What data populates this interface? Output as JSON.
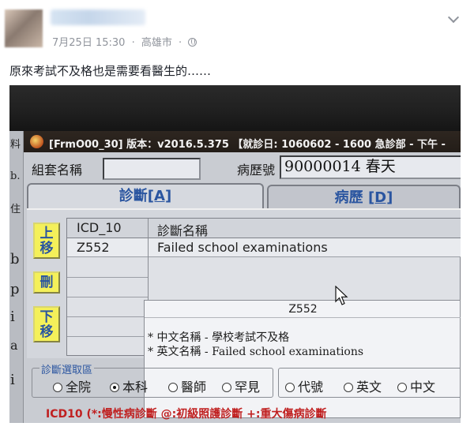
{
  "post": {
    "date": "7月25日 15:30",
    "separator": "·",
    "location": "高雄市",
    "separator2": "·",
    "caption": "原來考試不及格也是需要看醫生的……"
  },
  "app": {
    "title": "[FrmO00_30] 版本：v2016.5.375   【就診日: 1060602 - 1600 急診部 - 下午 -",
    "left_strip": [
      "料",
      "b.",
      "住",
      "b",
      "p",
      "i",
      "a",
      "i"
    ],
    "group_set_label": "組套名稱",
    "group_set_value": "",
    "chart_no_label": "病歷號",
    "chart_no_value": "90000014 春天",
    "tabs": [
      {
        "label": "診斷",
        "hotkey": "[A]"
      },
      {
        "label": "病歷",
        "hotkey": "[D]"
      }
    ],
    "side_buttons": [
      {
        "line1": "上",
        "line2": "移"
      },
      {
        "line1": "刪",
        "line2": ""
      },
      {
        "line1": "下",
        "line2": "移"
      }
    ],
    "grid": {
      "headers": [
        "ICD_10",
        "診斷名稱"
      ],
      "rows": [
        {
          "code": "Z552",
          "name": "Failed school examinations"
        }
      ]
    },
    "tooltip": {
      "code": "Z552",
      "lines": [
        "* 中文名稱 - 學校考試不及格",
        "* 英文名稱 - Failed school examinations"
      ]
    },
    "scope_group": {
      "label": "診斷選取區",
      "options": [
        {
          "label": "全院",
          "selected": false
        },
        {
          "label": "本科",
          "selected": true
        },
        {
          "label": "醫師",
          "selected": false
        },
        {
          "label": "罕見",
          "selected": false
        }
      ]
    },
    "search_group": {
      "options": [
        {
          "label": "代號",
          "selected": false
        },
        {
          "label": "英文",
          "selected": false
        },
        {
          "label": "中文",
          "selected": false
        }
      ]
    },
    "legend": "ICD10  (*:慢性病診斷    @:初級照護診斷    +:重大傷病診斷"
  },
  "colors": {
    "accent": "#2a55a0",
    "button_yellow": "#f4f05a",
    "legend_red": "#c02020"
  },
  "icons": [
    "globe-icon",
    "chevron-down-icon",
    "app-icon",
    "mouse-cursor-icon"
  ]
}
